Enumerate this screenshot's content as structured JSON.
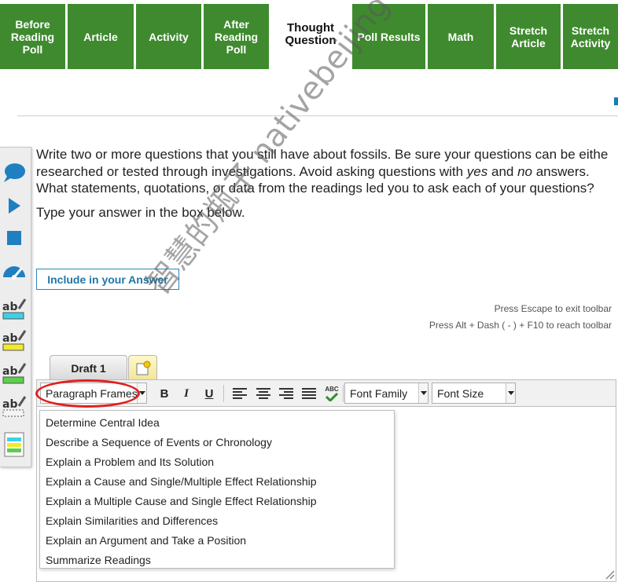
{
  "tabs": [
    {
      "label": "Before\nReading\nPoll",
      "active": false
    },
    {
      "label": "Article",
      "active": false
    },
    {
      "label": "Activity",
      "active": false
    },
    {
      "label": "After\nReading\nPoll",
      "active": false
    },
    {
      "label": "Thought\nQuestion",
      "active": true
    },
    {
      "label": "Poll Results",
      "active": false
    },
    {
      "label": "Math",
      "active": false
    },
    {
      "label": "Stretch\nArticle",
      "active": false
    },
    {
      "label": "Stretch\nActivity",
      "active": false
    }
  ],
  "colors": {
    "tab_green": "#3f8a2f",
    "accent_blue": "#1f77a8",
    "highlight_red": "#e02020"
  },
  "left_toolbar": {
    "icons": [
      "speech-bubble-icon",
      "play-icon",
      "stop-icon",
      "speed-gauge-icon",
      "highlighter-cyan-icon",
      "highlighter-yellow-icon",
      "highlighter-green-icon",
      "eraser-icon",
      "notes-icon"
    ]
  },
  "question": {
    "line1": "Write two or more questions that you still have about fossils. Be sure your questions can be eithe",
    "line2_pre": "researched or tested through investigations. Avoid asking questions with ",
    "line2_yes": "yes",
    "line2_mid": " and ",
    "line2_no": "no",
    "line2_post": " answers.",
    "line3": "What statements, quotations, or data from the readings led you to ask each of your questions?",
    "instruction": "Type your answer in the box below."
  },
  "include_button": "Include in your Answer",
  "hints": {
    "escape": "Press Escape to exit toolbar",
    "alt": "Press Alt + Dash ( - ) + F10 to reach toolbar"
  },
  "editor": {
    "draft_tab": "Draft 1",
    "paragraph_frames": "Paragraph Frames",
    "font_family": "Font Family",
    "font_size": "Font Size",
    "bold": "B",
    "italic": "I",
    "underline": "U",
    "spellcheck": "ABC"
  },
  "frames": [
    "Determine Central Idea",
    "Describe a Sequence of Events or Chronology",
    "Explain a Problem and Its Solution",
    "Explain a Cause and Single/Multiple Effect Relationship",
    "Explain a Multiple Cause and Single Effect Relationship",
    "Explain Similarities and Differences",
    "Explain an Argument and Take a Position",
    "Summarize Readings"
  ],
  "watermark": "智慧的瓶子 nativebeijing"
}
